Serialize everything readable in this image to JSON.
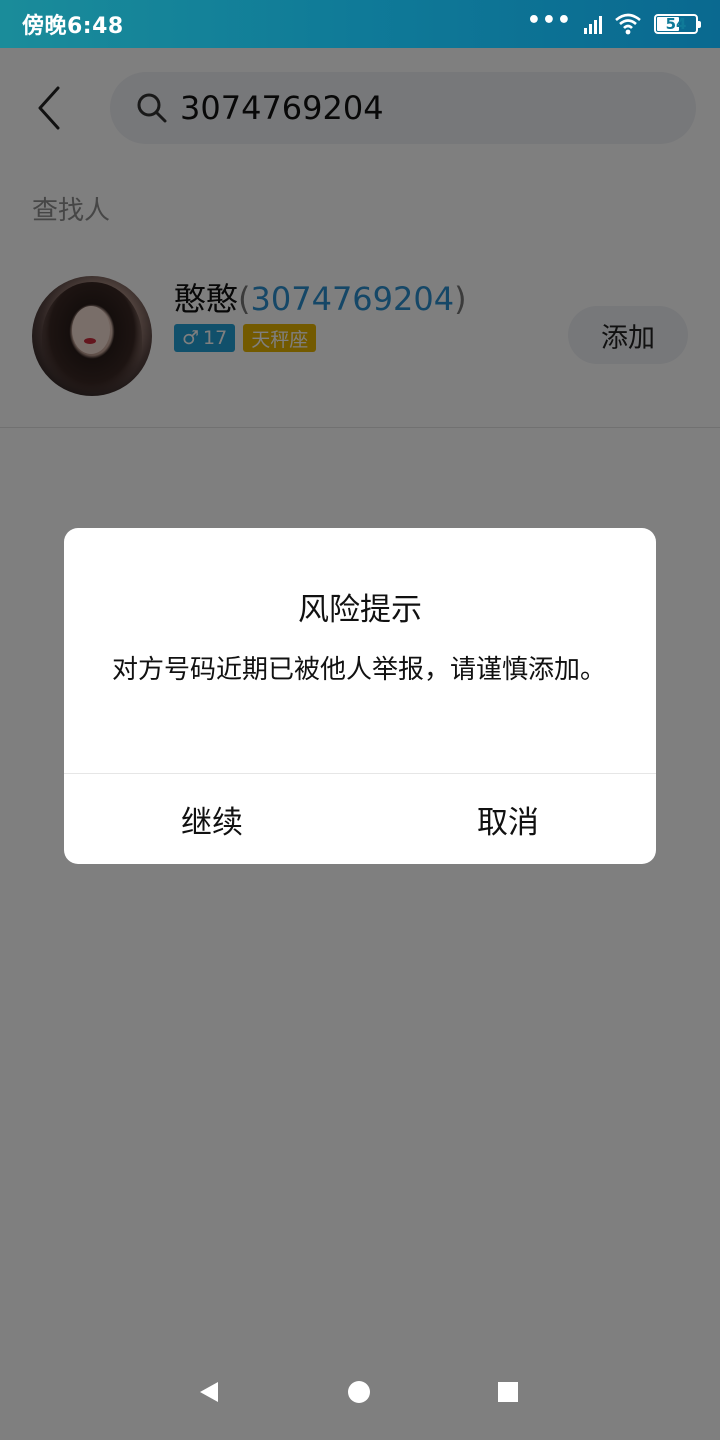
{
  "status_bar": {
    "time": "傍晚6:48",
    "battery": "54",
    "dots": "•••"
  },
  "search": {
    "value": "3074769204",
    "placeholder": ""
  },
  "section": {
    "label": "查找人"
  },
  "result": {
    "name": "憨憨",
    "uid": "3074769204",
    "paren_open": "(",
    "paren_close": ")",
    "gender_symbol": "♂",
    "age": "17",
    "zodiac": "天秤座",
    "add_label": "添加"
  },
  "dialog": {
    "title": "风险提示",
    "message": "对方号码近期已被他人举报，请谨慎添加。",
    "continue_label": "继续",
    "cancel_label": "取消"
  },
  "colors": {
    "accent_blue": "#2a8fcf",
    "gender_tag": "#23a0d6",
    "zodiac_tag": "#e6b400"
  }
}
